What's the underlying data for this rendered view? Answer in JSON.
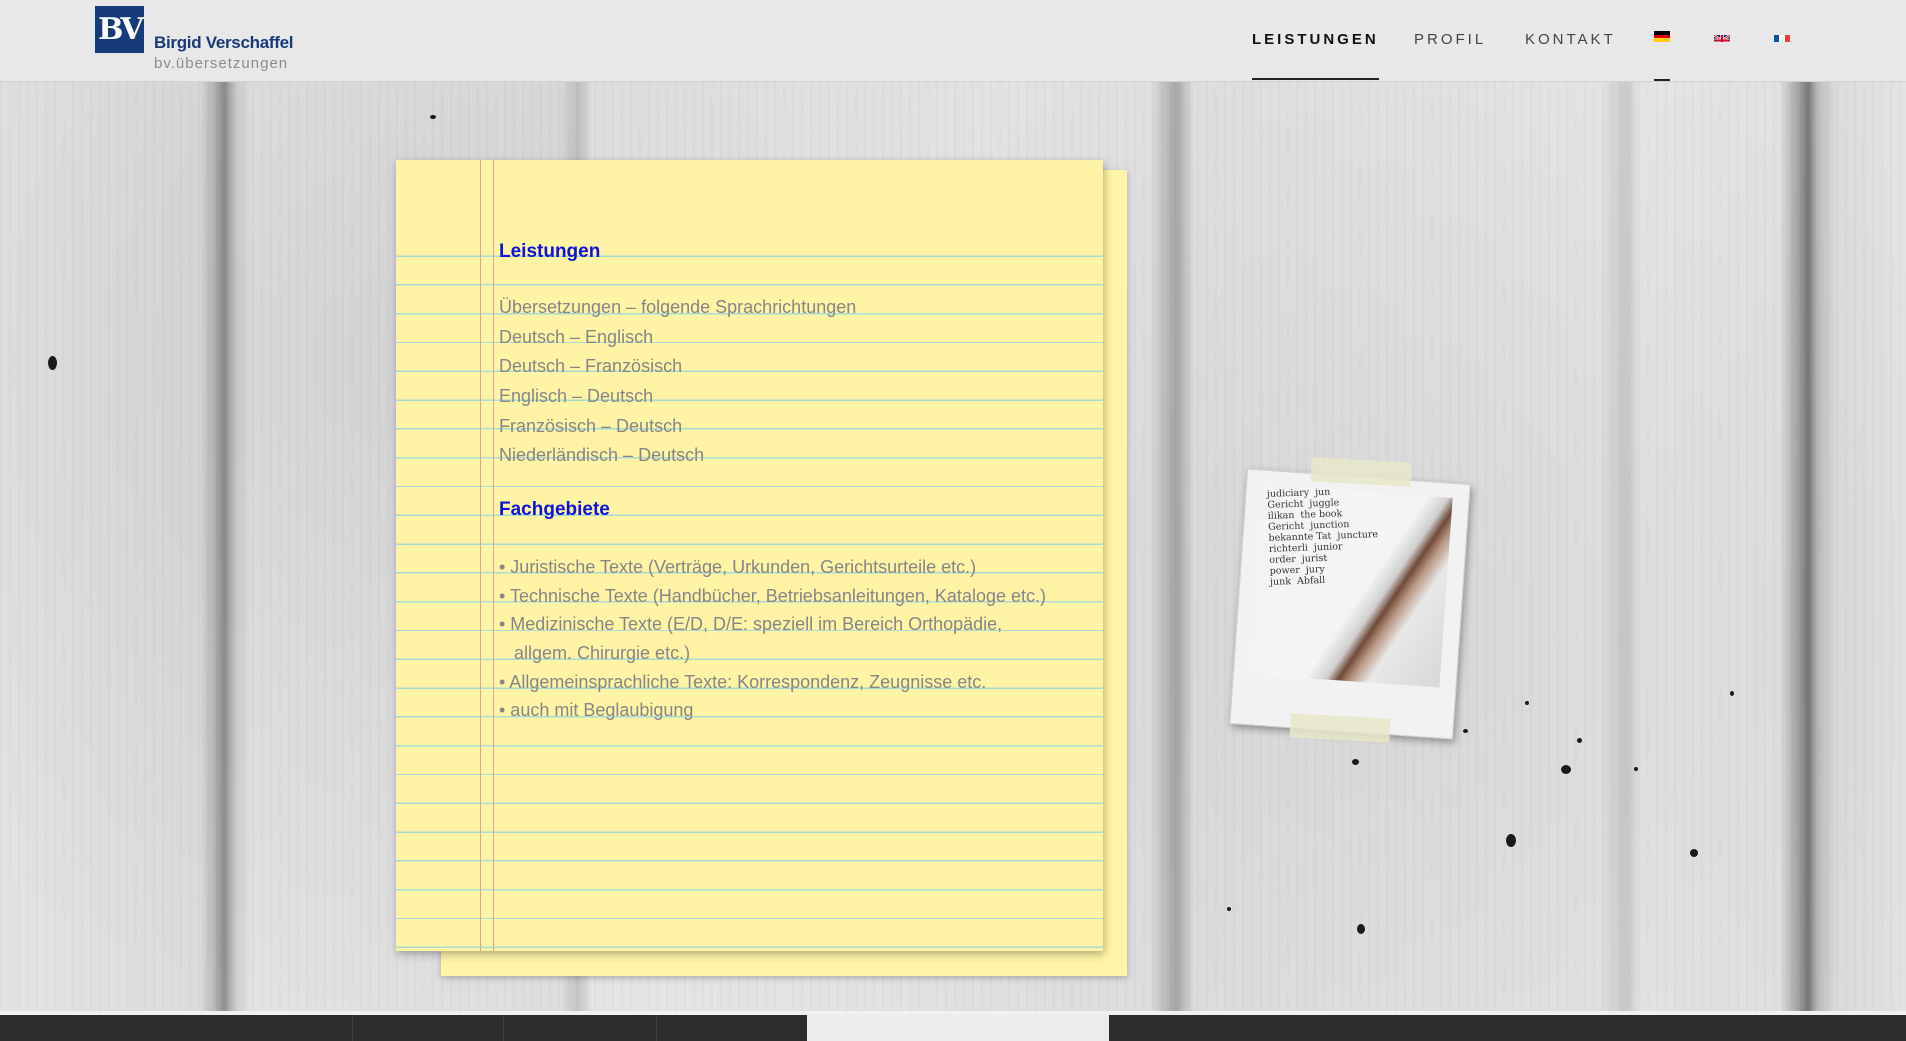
{
  "brand": {
    "mark": "BV",
    "name": "Birgid Verschaffel",
    "tagline": "bv.übersetzungen"
  },
  "nav": {
    "items": [
      {
        "label": "LEISTUNGEN",
        "active": true
      },
      {
        "label": "PROFIL",
        "active": false
      },
      {
        "label": "KONTAKT",
        "active": false
      }
    ],
    "languages": [
      {
        "icon": "flag-de-icon",
        "active": true
      },
      {
        "icon": "flag-gb-icon",
        "active": false
      },
      {
        "icon": "flag-fr-icon",
        "active": false
      }
    ]
  },
  "notepad": {
    "services_heading": "Leistungen",
    "services": [
      "Übersetzungen – folgende Sprachrichtungen",
      "Deutsch – Englisch",
      "Deutsch – Französisch",
      "Englisch – Deutsch",
      "Französisch – Deutsch",
      "Niederländisch – Deutsch"
    ],
    "fields_heading": "Fachgebiete",
    "fields": [
      "• Juristische Texte (Verträge, Urkunden, Gerichtsurteile etc.)",
      "• Technische Texte (Handbücher, Betriebsanleitungen, Kataloge etc.)",
      "• Medizinische Texte (E/D, D/E: speziell im Bereich Orthopädie,",
      "   allgem. Chirurgie etc.)",
      "• Allgemeinsprachliche Texte: Korrespondenz, Zeugnisse etc.",
      "• auch mit Beglaubigung"
    ]
  },
  "colors": {
    "brand_blue": "#173a78",
    "heading_blue": "#0d14d8",
    "paper_yellow": "#fff3a6",
    "text_gray": "#868686"
  }
}
